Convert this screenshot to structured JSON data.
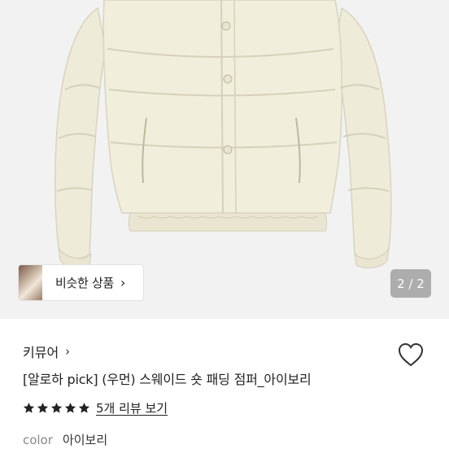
{
  "image": {
    "description_icon": "puffer-jacket-image",
    "background": "#f2f2f2",
    "jacket_color": "#eeebd8"
  },
  "similar": {
    "label": "비슷한 상품",
    "chevron": "›"
  },
  "pager": {
    "text": "2 / 2"
  },
  "brand": {
    "name": "키뮤어",
    "chevron": "›"
  },
  "product": {
    "name": "[알로하 pick] (우먼) 스웨이드 숏 패딩 점퍼_아이보리"
  },
  "rating": {
    "stars": 5,
    "max": 5,
    "review_label": "5개 리뷰 보기"
  },
  "attributes": {
    "color_key": "color",
    "color_value": "아이보리"
  }
}
